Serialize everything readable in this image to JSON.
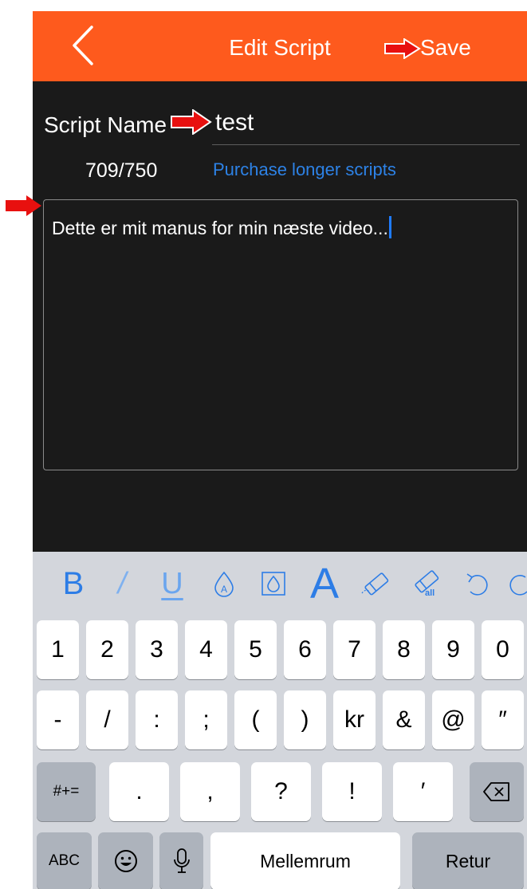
{
  "header": {
    "title": "Edit Script",
    "save_label": "Save"
  },
  "form": {
    "name_label": "Script Name",
    "name_value": "test",
    "char_count": "709/750",
    "purchase_link": "Purchase longer scripts",
    "script_text": "Dette er mit manus for min næste video..."
  },
  "format_toolbar": {
    "bold": "B",
    "italic": "/",
    "underline": "U",
    "font_size": "A",
    "eraser_all_label": "all"
  },
  "keyboard": {
    "row1": [
      "1",
      "2",
      "3",
      "4",
      "5",
      "6",
      "7",
      "8",
      "9",
      "0"
    ],
    "row2": [
      "-",
      "/",
      ":",
      ";",
      "(",
      ")",
      "kr",
      "&",
      "@",
      "″"
    ],
    "row3": [
      ".",
      ",",
      "?",
      "!",
      "′"
    ],
    "shift_label": "#+=",
    "abc_label": "ABC",
    "space_label": "Mellemrum",
    "return_label": "Retur"
  },
  "colors": {
    "accent": "#fe5a1d",
    "link": "#2d82e6",
    "annotation": "#e8100f"
  }
}
